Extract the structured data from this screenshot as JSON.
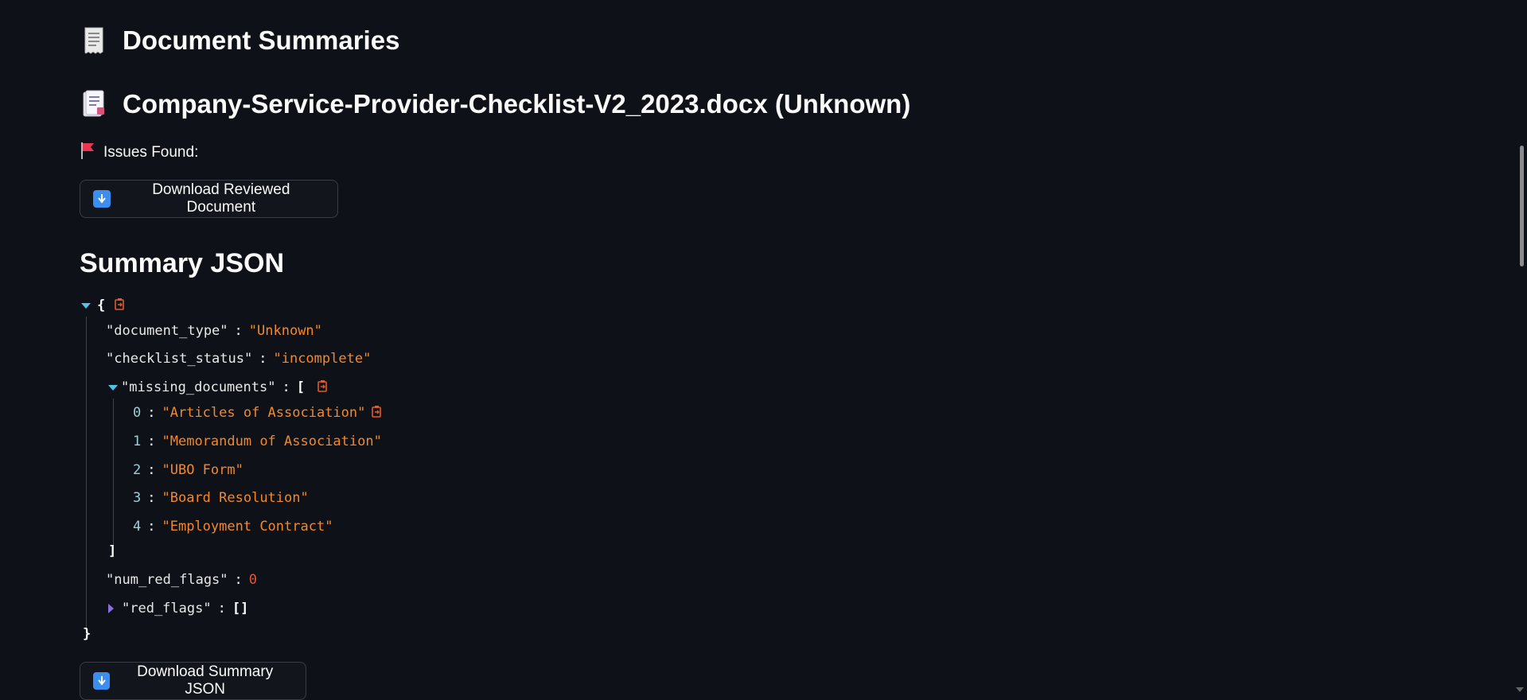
{
  "title": "Document Summaries",
  "document": {
    "name": "Company-Service-Provider-Checklist-V2_2023.docx (Unknown)"
  },
  "issues_label": "Issues Found:",
  "buttons": {
    "download_reviewed": "Download Reviewed Document",
    "download_summary": "Download Summary JSON"
  },
  "summary_title": "Summary JSON",
  "json": {
    "open_brace": "{",
    "close_brace": "}",
    "document_type_key": "\"document_type\"",
    "document_type_value": "\"Unknown\"",
    "checklist_status_key": "\"checklist_status\"",
    "checklist_status_value": "\"incomplete\"",
    "missing_documents_key": "\"missing_documents\"",
    "open_bracket": "[",
    "close_bracket": "]",
    "missing_documents": [
      {
        "index": "0",
        "value": "\"Articles of Association\""
      },
      {
        "index": "1",
        "value": "\"Memorandum of Association\""
      },
      {
        "index": "2",
        "value": "\"UBO Form\""
      },
      {
        "index": "3",
        "value": "\"Board Resolution\""
      },
      {
        "index": "4",
        "value": "\"Employment Contract\""
      }
    ],
    "num_red_flags_key": "\"num_red_flags\"",
    "num_red_flags_value": "0",
    "red_flags_key": "\"red_flags\"",
    "red_flags_value": "[]",
    "colon": ":"
  },
  "icons": {
    "title_icon": "receipt-icon",
    "doc_icon": "document-icon",
    "flag_icon": "red-flag-icon",
    "download_icon": "download-arrow-icon",
    "copy_icon": "copy-icon"
  },
  "colors": {
    "background": "#0e1117",
    "string": "#f2882c",
    "number": "#e8533a",
    "index": "#9ccfd6",
    "expand_toggle": "#4fc4e6",
    "collapsed_toggle": "#8b6fe0",
    "download_icon": "#3b8ef0"
  }
}
